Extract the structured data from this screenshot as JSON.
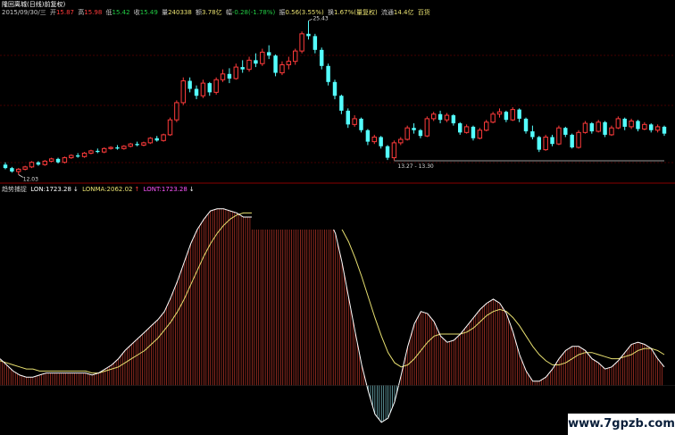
{
  "top_header": {
    "title": "隆回离城(日线)前复权)",
    "date": "2015/09/30/三",
    "open_label": "开",
    "open": "15.87",
    "high_label": "高",
    "high": "15.98",
    "low_label": "低",
    "low": "15.42",
    "close_label": "收",
    "close": "15.49",
    "volume_label": "量",
    "volume": "240338",
    "amount_label": "额",
    "amount": "3.78亿",
    "change_label": "幅",
    "change": "-0.28(-1.78%)",
    "amplitude_label": "振",
    "amplitude": "0.56(3.55%)",
    "turnover_label": "换",
    "turnover": "1.67%(量复权)",
    "float_label": "流通",
    "float_value": "14.4亿",
    "sector": "百货"
  },
  "top_annotations": {
    "peak": "25.43",
    "low": "12.03",
    "range": "13.27 - 13.30"
  },
  "bottom_header": {
    "title": "趋势捕捉",
    "lon_label": "LON:",
    "lon": "1723.28",
    "lonma_label": "LONMA:",
    "lonma": "2062.02",
    "lont_label": "LONT:",
    "lont": "1723.28"
  },
  "watermark": "www.7gpzb.com",
  "colors": {
    "up": "#ff3b3b",
    "down": "#54ffff",
    "lon": "#ffffff",
    "lonma": "#e8e070",
    "lont": "#ff55ff",
    "grid": "#8a0000",
    "hist_pos": "#c0392b",
    "hist_neg": "#7ec8d0"
  },
  "chart_data": [
    {
      "type": "candlestick",
      "title": "隆回离城(日线)前复权)",
      "y_annotations": [
        "25.43",
        "12.03",
        "13.27 - 13.30"
      ],
      "series": [
        {
          "name": "",
          "values": [
            [
              12.9,
              13.1,
              12.5,
              12.6
            ],
            [
              12.6,
              12.7,
              12.2,
              12.3
            ],
            [
              12.3,
              12.6,
              12.03,
              12.5
            ],
            [
              12.5,
              12.8,
              12.4,
              12.7
            ],
            [
              12.7,
              13.2,
              12.6,
              13.1
            ],
            [
              13.1,
              13.2,
              12.8,
              12.9
            ],
            [
              12.9,
              13.3,
              12.8,
              13.2
            ],
            [
              13.2,
              13.5,
              13.1,
              13.4
            ],
            [
              13.4,
              13.5,
              13.0,
              13.1
            ],
            [
              13.1,
              13.6,
              13.0,
              13.5
            ],
            [
              13.5,
              13.8,
              13.4,
              13.7
            ],
            [
              13.7,
              13.9,
              13.5,
              13.6
            ],
            [
              13.6,
              14.0,
              13.5,
              13.9
            ],
            [
              13.9,
              14.2,
              13.8,
              14.1
            ],
            [
              14.1,
              14.3,
              13.9,
              14.0
            ],
            [
              14.0,
              14.4,
              13.9,
              14.3
            ],
            [
              14.3,
              14.5,
              14.2,
              14.4
            ],
            [
              14.4,
              14.6,
              14.2,
              14.3
            ],
            [
              14.3,
              14.6,
              14.2,
              14.5
            ],
            [
              14.5,
              14.8,
              14.4,
              14.7
            ],
            [
              14.7,
              14.9,
              14.5,
              14.6
            ],
            [
              14.6,
              14.9,
              14.5,
              14.8
            ],
            [
              14.8,
              15.3,
              14.7,
              15.2
            ],
            [
              15.2,
              15.4,
              14.9,
              15.0
            ],
            [
              15.0,
              15.6,
              14.9,
              15.5
            ],
            [
              15.5,
              17.0,
              15.4,
              16.8
            ],
            [
              16.8,
              18.5,
              16.6,
              18.3
            ],
            [
              18.3,
              20.5,
              18.1,
              20.2
            ],
            [
              20.2,
              20.5,
              19.2,
              19.5
            ],
            [
              19.5,
              19.8,
              18.6,
              18.9
            ],
            [
              18.9,
              20.3,
              18.7,
              20.0
            ],
            [
              20.0,
              20.1,
              18.9,
              19.2
            ],
            [
              19.2,
              20.5,
              19.0,
              20.3
            ],
            [
              20.3,
              21.2,
              20.1,
              20.8
            ],
            [
              20.8,
              21.3,
              20.0,
              20.4
            ],
            [
              20.4,
              21.7,
              20.3,
              21.4
            ],
            [
              21.4,
              22.0,
              20.9,
              21.2
            ],
            [
              21.2,
              22.3,
              21.0,
              22.0
            ],
            [
              22.0,
              22.6,
              21.4,
              21.7
            ],
            [
              21.7,
              23.0,
              21.5,
              22.7
            ],
            [
              22.7,
              23.3,
              22.1,
              22.4
            ],
            [
              22.4,
              22.5,
              20.6,
              20.9
            ],
            [
              20.9,
              21.9,
              20.7,
              21.6
            ],
            [
              21.6,
              22.3,
              21.2,
              21.9
            ],
            [
              21.9,
              23.0,
              21.6,
              22.8
            ],
            [
              22.8,
              24.5,
              22.6,
              24.3
            ],
            [
              24.3,
              25.43,
              23.8,
              24.1
            ],
            [
              24.1,
              24.3,
              22.6,
              22.9
            ],
            [
              22.9,
              23.1,
              21.2,
              21.5
            ],
            [
              21.5,
              21.7,
              19.8,
              20.1
            ],
            [
              20.1,
              20.3,
              18.6,
              18.9
            ],
            [
              18.9,
              19.0,
              17.3,
              17.6
            ],
            [
              17.6,
              17.8,
              16.1,
              16.4
            ],
            [
              16.4,
              17.2,
              16.2,
              16.9
            ],
            [
              16.9,
              17.0,
              15.7,
              15.9
            ],
            [
              15.9,
              16.0,
              14.6,
              14.9
            ],
            [
              14.9,
              15.5,
              14.7,
              15.3
            ],
            [
              15.3,
              15.4,
              14.3,
              14.5
            ],
            [
              14.5,
              14.6,
              13.3,
              13.5
            ],
            [
              13.5,
              15.0,
              13.27,
              14.8
            ],
            [
              14.8,
              15.3,
              14.6,
              15.1
            ],
            [
              15.1,
              16.3,
              15.0,
              16.1
            ],
            [
              16.1,
              16.5,
              15.6,
              15.9
            ],
            [
              15.9,
              16.0,
              15.2,
              15.4
            ],
            [
              15.4,
              17.1,
              15.3,
              16.9
            ],
            [
              16.9,
              17.5,
              16.7,
              17.3
            ],
            [
              17.3,
              17.6,
              16.5,
              16.8
            ],
            [
              16.8,
              17.4,
              16.6,
              17.2
            ],
            [
              17.2,
              17.3,
              16.3,
              16.5
            ],
            [
              16.5,
              16.6,
              15.5,
              15.7
            ],
            [
              15.7,
              16.4,
              15.6,
              16.2
            ],
            [
              16.2,
              16.3,
              15.0,
              15.2
            ],
            [
              15.2,
              16.1,
              15.1,
              15.9
            ],
            [
              15.9,
              16.8,
              15.8,
              16.6
            ],
            [
              16.6,
              17.5,
              16.5,
              17.3
            ],
            [
              17.3,
              17.8,
              17.0,
              17.5
            ],
            [
              17.5,
              17.6,
              16.6,
              16.8
            ],
            [
              16.8,
              17.9,
              16.7,
              17.7
            ],
            [
              17.7,
              17.8,
              16.6,
              16.9
            ],
            [
              16.9,
              17.0,
              15.6,
              15.8
            ],
            [
              15.8,
              16.3,
              15.1,
              15.3
            ],
            [
              15.3,
              15.4,
              14.0,
              14.2
            ],
            [
              14.2,
              15.5,
              14.1,
              15.3
            ],
            [
              15.3,
              15.5,
              14.5,
              14.7
            ],
            [
              14.7,
              16.3,
              14.6,
              16.1
            ],
            [
              16.1,
              16.2,
              15.3,
              15.5
            ],
            [
              15.5,
              15.6,
              14.3,
              14.4
            ],
            [
              14.4,
              15.9,
              14.3,
              15.7
            ],
            [
              15.7,
              16.7,
              15.6,
              16.5
            ],
            [
              16.5,
              16.6,
              15.6,
              15.8
            ],
            [
              15.8,
              16.8,
              15.7,
              16.6
            ],
            [
              16.6,
              16.7,
              15.3,
              15.5
            ],
            [
              15.5,
              16.3,
              15.4,
              16.1
            ],
            [
              16.1,
              17.1,
              16.0,
              16.9
            ],
            [
              16.9,
              17.0,
              15.9,
              16.2
            ],
            [
              16.2,
              16.9,
              16.0,
              16.7
            ],
            [
              16.7,
              16.8,
              15.8,
              16.0
            ],
            [
              16.0,
              16.6,
              15.9,
              16.4
            ],
            [
              16.4,
              16.5,
              15.7,
              15.9
            ],
            [
              15.9,
              16.4,
              15.7,
              16.2
            ],
            [
              16.2,
              16.3,
              15.4,
              15.6
            ]
          ]
        }
      ],
      "value_format": "[open, high, low, close]",
      "ylim": [
        11.6,
        26.0
      ],
      "grid": true
    },
    {
      "type": "bar",
      "title": "趋势捕捉",
      "series": [
        {
          "name": "LON",
          "values": [
            1.3,
            1.0,
            0.7,
            0.5,
            0.4,
            0.4,
            0.5,
            0.6,
            0.6,
            0.6,
            0.6,
            0.6,
            0.6,
            0.6,
            0.5,
            0.6,
            0.8,
            1.0,
            1.3,
            1.7,
            2.0,
            2.3,
            2.6,
            2.9,
            3.2,
            3.6,
            4.3,
            5.1,
            6.0,
            6.9,
            7.6,
            8.1,
            8.5,
            8.6,
            8.6,
            8.5,
            8.4,
            8.2,
            8.2,
            8.2,
            8.2,
            8.2,
            8.2,
            8.2,
            8.2,
            8.2,
            8.2,
            8.2,
            8.2,
            8.2,
            8.1,
            7.4,
            6.0,
            4.3,
            2.6,
            1.0,
            -0.3,
            -1.4,
            -1.8,
            -1.6,
            -0.8,
            0.5,
            1.9,
            3.0,
            3.6,
            3.5,
            3.1,
            2.4,
            2.1,
            2.2,
            2.5,
            2.9,
            3.3,
            3.7,
            4.0,
            4.2,
            4.0,
            3.5,
            2.6,
            1.5,
            0.7,
            0.2,
            0.2,
            0.4,
            0.8,
            1.3,
            1.7,
            1.9,
            1.9,
            1.7,
            1.3,
            1.1,
            0.8,
            0.9,
            1.2,
            1.6,
            2.0,
            2.1,
            2.0,
            1.8,
            1.3,
            0.9
          ]
        },
        {
          "name": "LONMA",
          "values": [
            1.2,
            1.1,
            1.0,
            0.9,
            0.8,
            0.8,
            0.7,
            0.7,
            0.7,
            0.7,
            0.7,
            0.7,
            0.7,
            0.7,
            0.6,
            0.6,
            0.7,
            0.8,
            0.9,
            1.1,
            1.3,
            1.5,
            1.7,
            2.0,
            2.3,
            2.7,
            3.1,
            3.6,
            4.2,
            4.9,
            5.6,
            6.3,
            6.9,
            7.4,
            7.8,
            8.1,
            8.3,
            8.4,
            8.4,
            8.4,
            8.3,
            8.3,
            8.2,
            8.2,
            8.2,
            8.2,
            8.2,
            8.2,
            8.2,
            8.2,
            8.2,
            8.0,
            7.6,
            7.0,
            6.2,
            5.3,
            4.3,
            3.3,
            2.4,
            1.6,
            1.1,
            0.9,
            1.0,
            1.3,
            1.7,
            2.1,
            2.4,
            2.5,
            2.5,
            2.5,
            2.5,
            2.6,
            2.8,
            3.1,
            3.4,
            3.6,
            3.7,
            3.6,
            3.3,
            2.9,
            2.4,
            1.9,
            1.5,
            1.2,
            1.0,
            1.0,
            1.1,
            1.3,
            1.5,
            1.6,
            1.6,
            1.5,
            1.4,
            1.3,
            1.3,
            1.4,
            1.5,
            1.7,
            1.8,
            1.8,
            1.7,
            1.5
          ]
        }
      ],
      "ylim": [
        -2.2,
        9.2
      ],
      "grid": false
    }
  ]
}
